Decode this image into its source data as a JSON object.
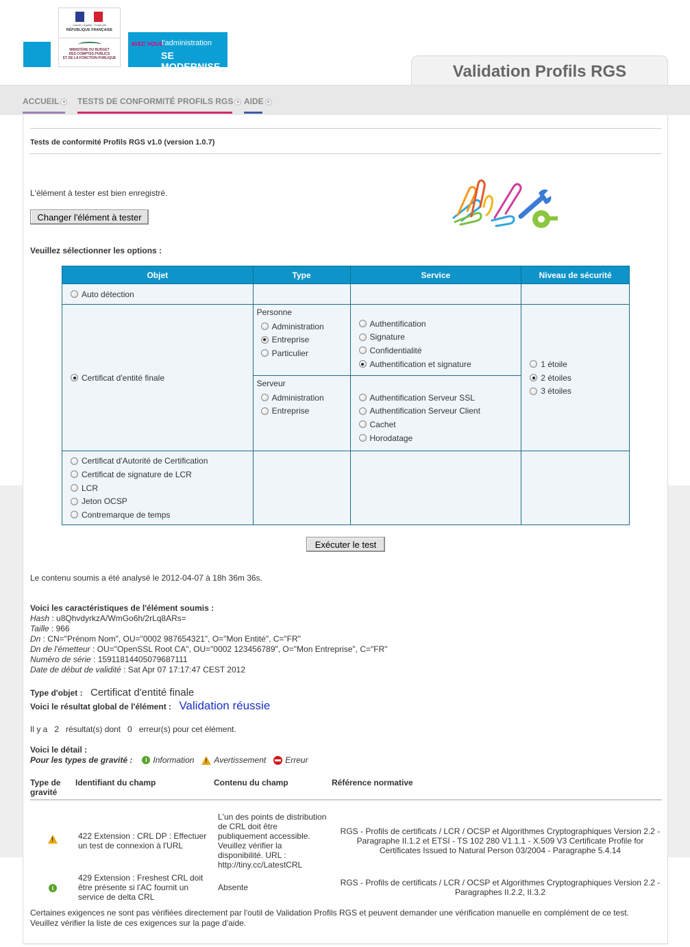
{
  "header": {
    "rf_motto": "Liberté • Égalité • Fraternité",
    "rf_name": "RÉPUBLIQUE FRANÇAISE",
    "ministry": [
      "MINISTÈRE DU BUDGET",
      "DES COMPTES PUBLICS",
      "ET DE LA FONCTION PUBLIQUE"
    ],
    "modernise_avec": "AVEC VOUS",
    "modernise_adm": "l'administration",
    "modernise_se": "SE MODERNISE",
    "app_title": "Validation Profils RGS"
  },
  "nav": {
    "home": "ACCUEIL",
    "tests": "TESTS DE CONFORMITÉ PROFILS RGS",
    "aide": "AIDE"
  },
  "page": {
    "heading": "Tests de conformité Profils RGS v1.0 (version 1.0.7)",
    "registered": "L'élément à tester est bien enregistré.",
    "change_button": "Changer l'élément à tester",
    "select_options": "Veuillez sélectionner les options :",
    "run_button": "Exécuter le test",
    "analysed": "Le contenu soumis a été analysé le 2012-04-07 à 18h 36m 36s."
  },
  "options": {
    "headers": [
      "Objet",
      "Type",
      "Service",
      "Niveau de sécurité"
    ],
    "auto": "Auto détection",
    "cert_final": "Certificat d'entité finale",
    "personne_label": "Personne",
    "personne_types": [
      "Administration",
      "Entreprise",
      "Particulier"
    ],
    "personne_services": [
      "Authentification",
      "Signature",
      "Confidentialité",
      "Authentification et signature"
    ],
    "serveur_label": "Serveur",
    "serveur_types": [
      "Administration",
      "Entreprise"
    ],
    "serveur_services": [
      "Authentification Serveur SSL",
      "Authentification Serveur Client",
      "Cachet",
      "Horodatage"
    ],
    "levels": [
      "1 étoile",
      "2 étoiles",
      "3 étoiles"
    ],
    "other_objects": [
      "Certificat d'Autorité de Certification",
      "Certificat de signature de LCR",
      "LCR",
      "Jeton OCSP",
      "Contremarque de temps"
    ]
  },
  "details": {
    "heading": "Voici les caractéristiques de l'élément soumis :",
    "hash_label": "Hash",
    "hash": " : u8QhvdyrkzA/WmGo6h/2rLq8ARs=",
    "size_label": "Taille",
    "size": " : 966",
    "dn_label": "Dn",
    "dn": " : CN=\"Prénom Nom\", OU=\"0002 987654321\", O=\"Mon Entité\", C=\"FR\"",
    "issuer_label": "Dn de l'émetteur",
    "issuer": " : OU=\"OpenSSL Root CA\", OU=\"0002 123456789\", O=\"Mon Entreprise\", C=\"FR\"",
    "serial_label": "Numéro de série",
    "serial": " : 15911814405079687111",
    "validity_label": "Date de début de validité",
    "validity": " : Sat Apr 07 17:17:47 CEST 2012"
  },
  "result": {
    "type_label": "Type d'objet :",
    "type_value": "Certificat d'entité finale",
    "global_label": "Voici le résultat global de l'élément :",
    "global_value": "Validation réussie",
    "count_text": "Il y a   2   résultat(s) dont   0   erreur(s) pour cet élément.",
    "detail_label": "Voici le détail :",
    "gravity_label": "Pour les types de gravité :",
    "legend_info": "Information",
    "legend_warn": "Avertissement",
    "legend_err": "Erreur",
    "columns": [
      "Type de gravité",
      "Identifiant du champ",
      "Contenu du champ",
      "Référence normative"
    ],
    "rows": [
      {
        "severity_icon": "warning-icon",
        "id": "422 Extension : CRL DP : Effectuer un test de connexion à l'URL",
        "content": "L'un des points de distribution de CRL doit être publiquement accessible. Veuillez vérifier la disponibilité. URL : http://tiny.cc/LatestCRL",
        "reference": "RGS - Profils de certificats / LCR / OCSP et Algorithmes Cryptographiques Version 2.2 - Paragraphe II.1.2 et ETSI - TS 102 280 V1.1.1 - X.509 V3 Certificate Profile for Certificates Issued to Natural Person 03/2004 - Paragraphe 5.4.14"
      },
      {
        "severity_icon": "info-icon",
        "id": "429 Extension : Freshest CRL doit être présente si l'AC fournit un service de delta CRL",
        "content": "Absente",
        "reference": "RGS - Profils de certificats / LCR / OCSP et Algorithmes Cryptographiques Version 2.2 - Paragraphes II.2.2, II.3.2"
      }
    ],
    "footer1": "Certaines exigences ne sont pas vérifiées directement par l'outil de Validation Profils RGS et peuvent demander une vérification manuelle en complément de ce test.",
    "footer2": "Veuillez vérifier la liste de ces exigences sur la page d'aide."
  },
  "colors": {
    "accent_blue": "#0f94c9",
    "success_text": "#1a2fc8",
    "nav_purple": "#9a7fb5",
    "nav_pink": "#d4276b",
    "nav_navy": "#3a5aa8"
  }
}
